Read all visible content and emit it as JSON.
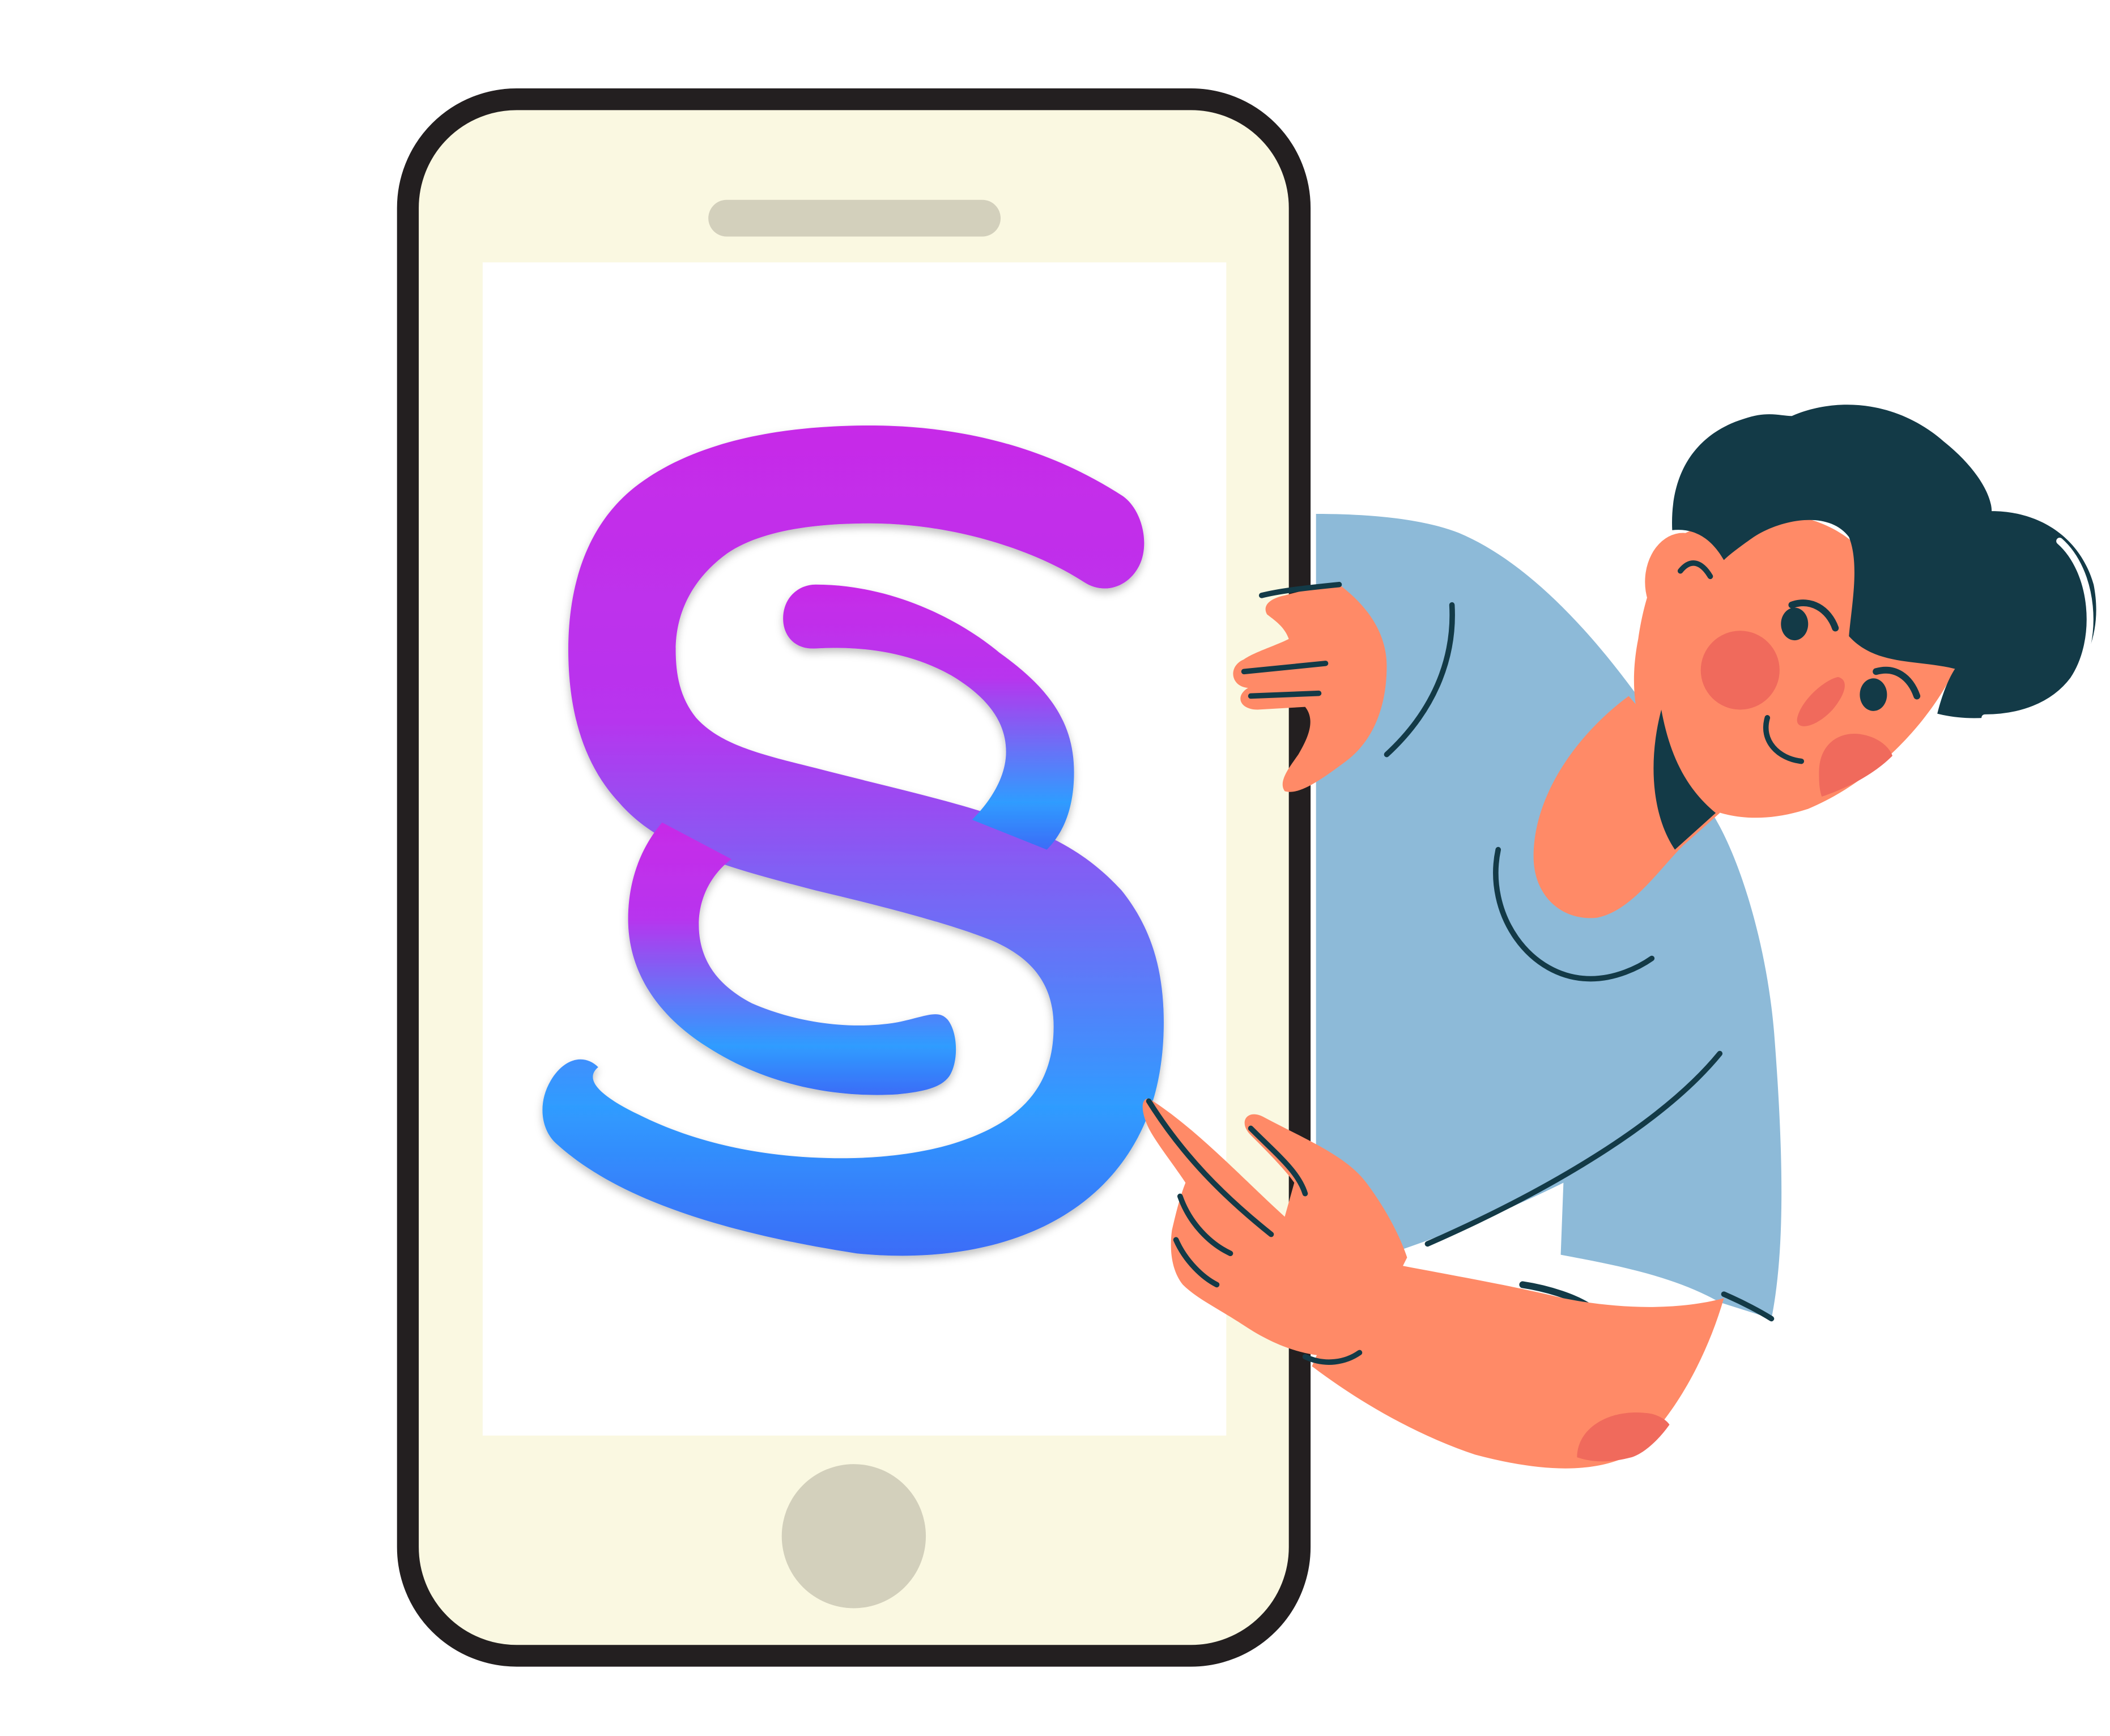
{
  "illustration": {
    "logo_icon": "section-sign-logo",
    "phone_icon": "smartphone-icon",
    "person_icon": "person-peeking-icon"
  },
  "colors": {
    "background": "#ffffff",
    "phone_body": "#faf8e1",
    "phone_outline": "#231f20",
    "phone_details": "#d3d0bc",
    "screen": "#ffffff",
    "logo_gradient_top": "#c42ae8",
    "logo_gradient_mid": "#8b5cf6",
    "logo_gradient_bottom": "#2f9cff",
    "logo_gradient_end": "#3a6cf7",
    "skin": "#ff8a67",
    "cheek": "#f06a5c",
    "hair": "#133a47",
    "shirt": "#8dbad8",
    "line": "#133a47"
  }
}
